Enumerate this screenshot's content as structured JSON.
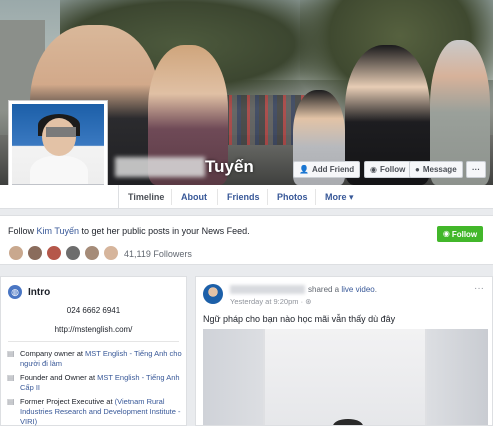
{
  "profile": {
    "name_visible": "Tuyến",
    "buttons": {
      "add_friend": "Add Friend",
      "follow": "Follow",
      "message": "Message",
      "more": "···"
    }
  },
  "nav": {
    "tabs": [
      "Timeline",
      "About",
      "Friends",
      "Photos",
      "More ▾"
    ]
  },
  "follow_banner": {
    "message_prefix": "Follow ",
    "name_link": "Kim Tuyến",
    "message_suffix": " to get her public posts in your News Feed.",
    "button": "Follow",
    "followers": "41,119 Followers"
  },
  "intro": {
    "title": "Intro",
    "phone": "024 6662 6941",
    "url": "http://mstenglish.com/",
    "work": [
      {
        "prefix": "Company owner at ",
        "link": "MST English - Tiếng Anh cho người đi làm"
      },
      {
        "prefix": "Founder and Owner at ",
        "link": "MST English - Tiếng Anh Cấp II"
      },
      {
        "prefix": "Former Project Executive at ",
        "link": "(Vietnam Rural Industries Research and Development Institute - VIRI)"
      }
    ]
  },
  "post": {
    "shared_prefix": "shared a ",
    "shared_link": "live video",
    "shared_suffix": ".",
    "time": "Yesterday at 9:20pm · ",
    "globe": "⊛",
    "dots": "···",
    "text": "Ngữ pháp cho bạn nào học mãi vẫn thấy dù đây"
  },
  "colors": {
    "link": "#385898",
    "follow_green": "#42b72a",
    "page_bg": "#e9ebee"
  }
}
